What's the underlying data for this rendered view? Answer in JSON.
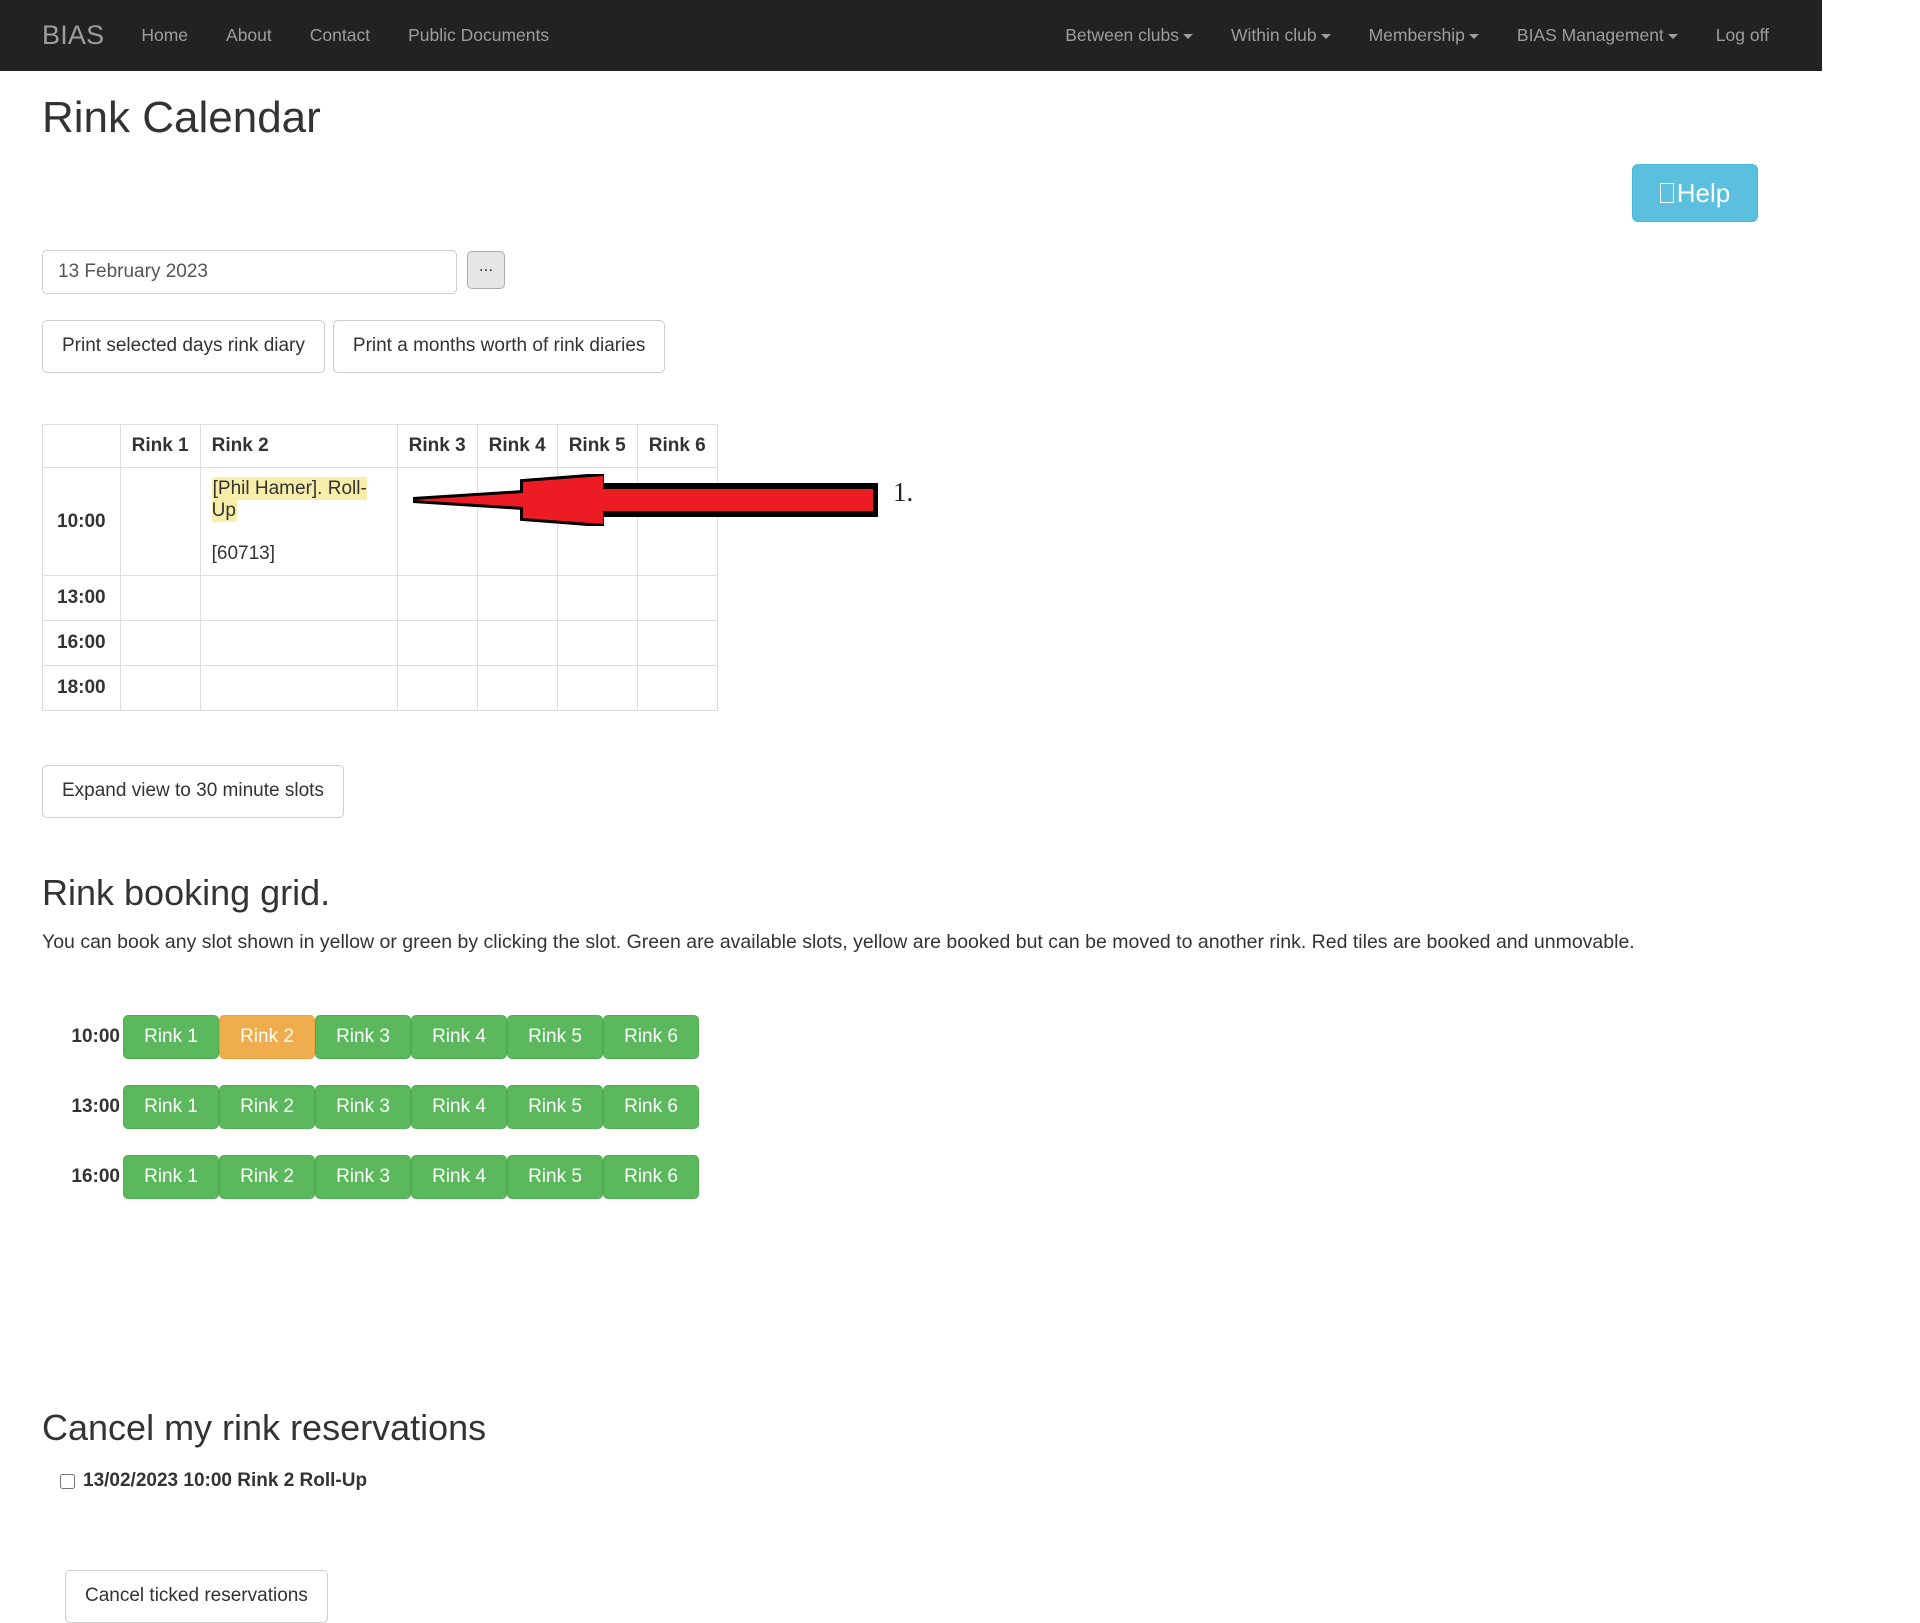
{
  "navbar": {
    "brand": "BIAS",
    "left_items": [
      {
        "label": "Home",
        "caret": false
      },
      {
        "label": "About",
        "caret": false
      },
      {
        "label": "Contact",
        "caret": false
      },
      {
        "label": "Public Documents",
        "caret": false
      }
    ],
    "right_items": [
      {
        "label": "Between clubs",
        "caret": true
      },
      {
        "label": "Within club",
        "caret": true
      },
      {
        "label": "Membership",
        "caret": true
      },
      {
        "label": "BIAS Management",
        "caret": true
      },
      {
        "label": "Log off",
        "caret": false
      }
    ]
  },
  "page": {
    "title": "Rink Calendar"
  },
  "help": {
    "label": "Help",
    "icon": "missing-glyph-box",
    "color": "#5bc0de"
  },
  "date_picker": {
    "value": "13 February 2023",
    "placeholder": "13 February 2023",
    "browse_label": "..."
  },
  "print_buttons": [
    {
      "label": "Print selected days rink diary"
    },
    {
      "label": "Print a months worth of rink diaries"
    }
  ],
  "calendar": {
    "columns": [
      "",
      "Rink 1",
      "Rink 2",
      "Rink 3",
      "Rink 4",
      "Rink 5",
      "Rink 6"
    ],
    "rows": [
      {
        "time": "10:00",
        "cells": [
          {
            "text": "",
            "highlight": false,
            "id": ""
          },
          {
            "text": "[Phil Hamer]. Roll-Up",
            "highlight": true,
            "id": "[60713]"
          },
          {
            "text": "",
            "highlight": false,
            "id": ""
          },
          {
            "text": "",
            "highlight": false,
            "id": ""
          },
          {
            "text": "",
            "highlight": false,
            "id": ""
          },
          {
            "text": "",
            "highlight": false,
            "id": ""
          }
        ]
      },
      {
        "time": "13:00",
        "cells": [
          {
            "text": ""
          },
          {
            "text": ""
          },
          {
            "text": ""
          },
          {
            "text": ""
          },
          {
            "text": ""
          },
          {
            "text": ""
          }
        ]
      },
      {
        "time": "16:00",
        "cells": [
          {
            "text": ""
          },
          {
            "text": ""
          },
          {
            "text": ""
          },
          {
            "text": ""
          },
          {
            "text": ""
          },
          {
            "text": ""
          }
        ]
      },
      {
        "time": "18:00",
        "cells": [
          {
            "text": ""
          },
          {
            "text": ""
          },
          {
            "text": ""
          },
          {
            "text": ""
          },
          {
            "text": ""
          },
          {
            "text": ""
          }
        ]
      }
    ]
  },
  "annotation": {
    "number": "1.",
    "arrow_color": "#ed1c24",
    "arrow_outline": "#000000"
  },
  "expand_button": {
    "label": "Expand view to 30 minute slots"
  },
  "booking_grid": {
    "title": "Rink booking grid.",
    "description": "You can book any slot shown in yellow or green by clicking the slot. Green are available slots, yellow are booked but can be moved to another rink. Red tiles are booked and unmovable.",
    "legend_colors": {
      "available": "#5cb85c",
      "movable": "#f0ad4e",
      "unmovable": "#d9534f"
    },
    "rows": [
      {
        "time": "10:00",
        "slots": [
          {
            "label": "Rink 1",
            "state": "green"
          },
          {
            "label": "Rink 2",
            "state": "yellow"
          },
          {
            "label": "Rink 3",
            "state": "green"
          },
          {
            "label": "Rink 4",
            "state": "green"
          },
          {
            "label": "Rink 5",
            "state": "green"
          },
          {
            "label": "Rink 6",
            "state": "green"
          }
        ]
      },
      {
        "time": "13:00",
        "slots": [
          {
            "label": "Rink 1",
            "state": "green"
          },
          {
            "label": "Rink 2",
            "state": "green"
          },
          {
            "label": "Rink 3",
            "state": "green"
          },
          {
            "label": "Rink 4",
            "state": "green"
          },
          {
            "label": "Rink 5",
            "state": "green"
          },
          {
            "label": "Rink 6",
            "state": "green"
          }
        ]
      },
      {
        "time": "16:00",
        "slots": [
          {
            "label": "Rink 1",
            "state": "green"
          },
          {
            "label": "Rink 2",
            "state": "green"
          },
          {
            "label": "Rink 3",
            "state": "green"
          },
          {
            "label": "Rink 4",
            "state": "green"
          },
          {
            "label": "Rink 5",
            "state": "green"
          },
          {
            "label": "Rink 6",
            "state": "green"
          }
        ]
      }
    ]
  },
  "cancel_section": {
    "title": "Cancel my rink reservations",
    "reservations": [
      {
        "label": "13/02/2023 10:00 Rink 2 Roll-Up",
        "checked": false
      }
    ],
    "button_label": "Cancel ticked reservations"
  }
}
